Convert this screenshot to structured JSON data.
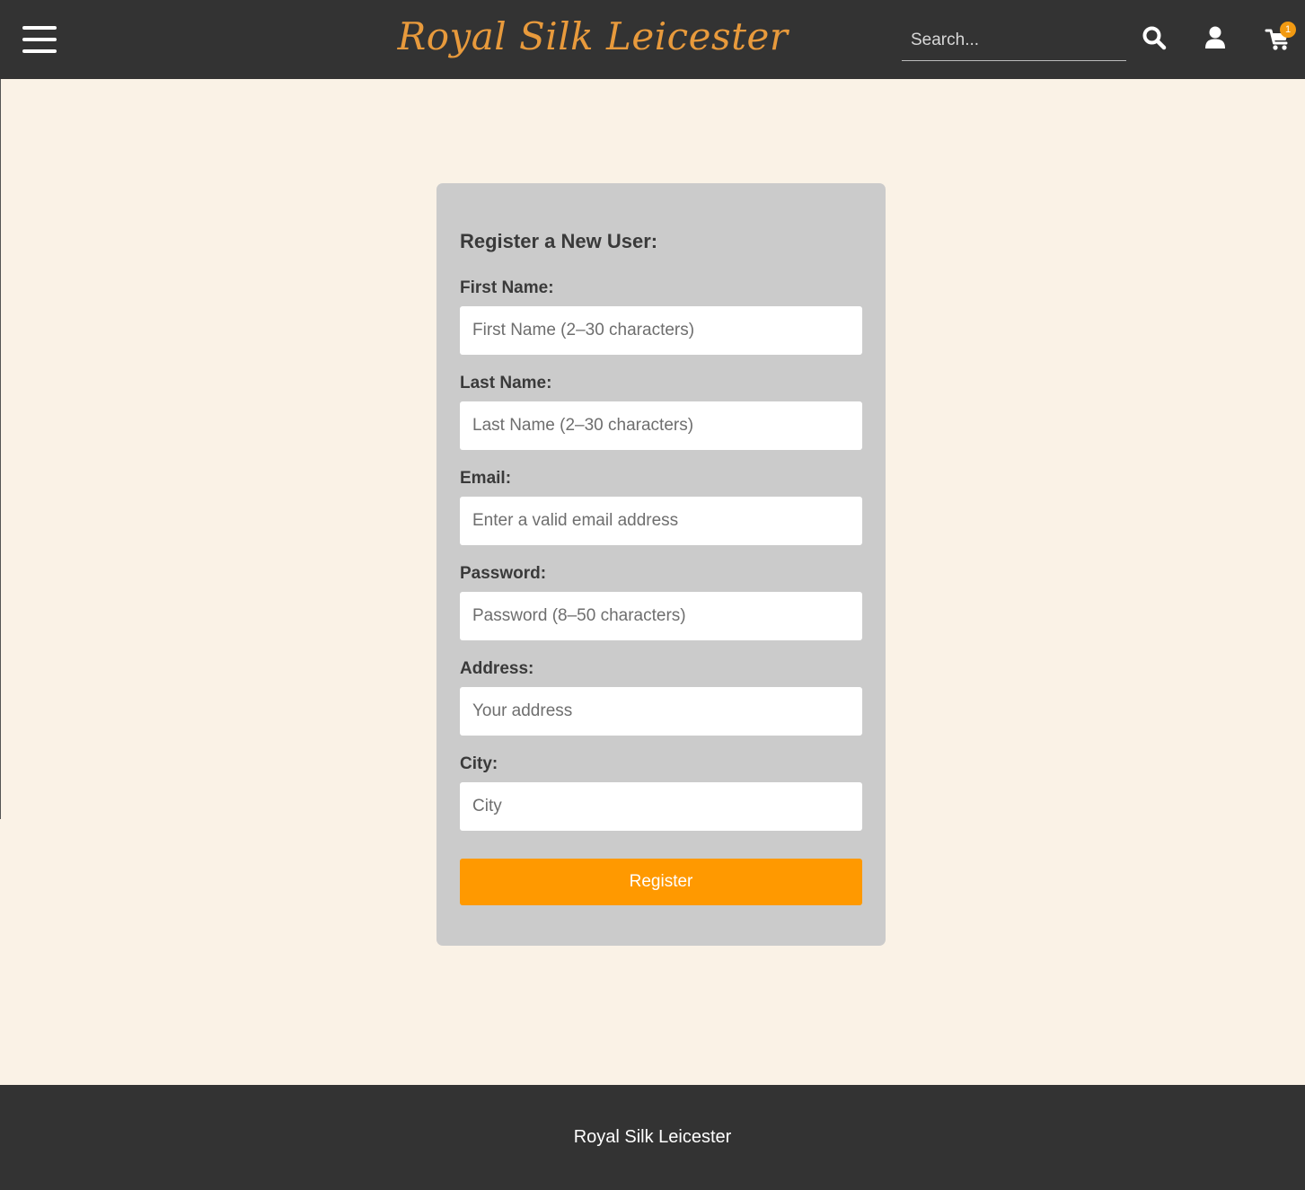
{
  "header": {
    "logo_text": "Royal Silk Leicester",
    "search": {
      "placeholder": "Search...",
      "value": ""
    },
    "menu_icon": "hamburger-menu-icon",
    "search_icon": "search-icon",
    "account_icon": "user-icon",
    "cart_icon": "shopping-cart-icon",
    "cart_count": "1"
  },
  "form": {
    "title": "Register a New User:",
    "fields": [
      {
        "label": "First Name:",
        "placeholder": "First Name (2–30 characters)",
        "value": ""
      },
      {
        "label": "Last Name:",
        "placeholder": "Last Name (2–30 characters)",
        "value": ""
      },
      {
        "label": "Email:",
        "placeholder": "Enter a valid email address",
        "value": ""
      },
      {
        "label": "Password:",
        "placeholder": "Password (8–50 characters)",
        "value": ""
      },
      {
        "label": "Address:",
        "placeholder": "Your address",
        "value": ""
      },
      {
        "label": "City:",
        "placeholder": "City",
        "value": ""
      }
    ],
    "submit_label": "Register"
  },
  "footer": {
    "text": "Royal Silk Leicester"
  },
  "colors": {
    "header_bg": "#333333",
    "page_bg": "#faf2e6",
    "logo": "#e89a3c",
    "card_bg": "#cbcbcb",
    "accent": "#ff9900",
    "badge": "#f29a12"
  }
}
